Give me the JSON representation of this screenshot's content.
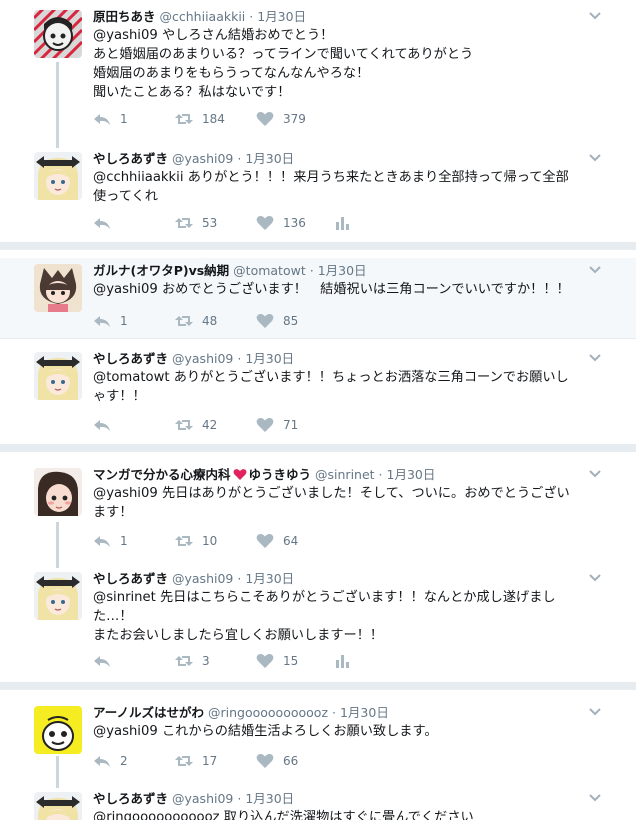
{
  "groups": [
    {
      "tweets": [
        {
          "name": "原田ちあき",
          "handle": "@cchhiiaakkii",
          "time": "1月30日",
          "lines": [
            "@yashi09 やしろさん結婚おめでとう！",
            "あと婚姻届のあまりいる？ってラインで聞いてくれてありがとう",
            "婚姻届のあまりをもらうってなんなんやろな！",
            "聞いたことある？私はないです！"
          ],
          "reply_count": "1",
          "retweet_count": "184",
          "like_count": "379"
        },
        {
          "name": "やしろあずき",
          "handle": "@yashi09",
          "time": "1月30日",
          "lines": [
            "@cchhiiaakkii ありがとう！！！来月うち来たときあまり全部持って帰って全部",
            "使ってくれ"
          ],
          "reply_count": "",
          "retweet_count": "53",
          "like_count": "136"
        }
      ]
    },
    {
      "tweets": [
        {
          "name": "ガルナ(オワタP)vs納期",
          "handle": "@tomatowt",
          "time": "1月30日",
          "lines": [
            "@yashi09 おめでとうございます！　結婚祝いは三角コーンでいいですか！！！"
          ],
          "reply_count": "1",
          "retweet_count": "48",
          "like_count": "85"
        },
        {
          "name": "やしろあずき",
          "handle": "@yashi09",
          "time": "1月30日",
          "lines": [
            "@tomatowt ありがとうございます！！ちょっとお洒落な三角コーンでお願いし",
            "ゃす！！"
          ],
          "reply_count": "",
          "retweet_count": "42",
          "like_count": "71"
        }
      ]
    },
    {
      "tweets": [
        {
          "name": "マンガで分かる心療内科",
          "name_tail": "ゆうきゆう",
          "handle": "@sinrinet",
          "time": "1月30日",
          "lines": [
            "@yashi09 先日はありがとうございました！そして、ついに。おめでとうござい",
            "ます！"
          ],
          "reply_count": "1",
          "retweet_count": "10",
          "like_count": "64"
        },
        {
          "name": "やしろあずき",
          "handle": "@yashi09",
          "time": "1月30日",
          "lines": [
            "@sinrinet 先日はこちらこそありがとうございます！！なんとか成し遂げまし",
            "た…！",
            "またお会いしましたら宜しくお願いしますー！！"
          ],
          "reply_count": "",
          "retweet_count": "3",
          "like_count": "15"
        }
      ]
    },
    {
      "tweets": [
        {
          "name": "アーノルズはせがわ",
          "handle": "@ringooooooooooz",
          "time": "1月30日",
          "lines": [
            "@yashi09 これからの結婚生活よろしくお願い致します。"
          ],
          "reply_count": "2",
          "retweet_count": "17",
          "like_count": "66"
        },
        {
          "name": "やしろあずき",
          "handle": "@yashi09",
          "time": "1月30日",
          "lines": [
            "@ringooooooooooz 取り込んだ洗濯物はすぐに畳んでください"
          ],
          "reply_count": "",
          "retweet_count": "",
          "like_count": ""
        }
      ]
    }
  ],
  "colors": {
    "text": "#14171a",
    "muted": "#657786",
    "separator": "#e6ecf0",
    "thread_line": "#ccd6dd",
    "highlight": "#f5f8fa",
    "heart": "#e0245e"
  },
  "icons": [
    "reply-icon",
    "retweet-icon",
    "like-icon",
    "analytics-icon",
    "caret-down-icon",
    "heart-emoji-icon"
  ]
}
